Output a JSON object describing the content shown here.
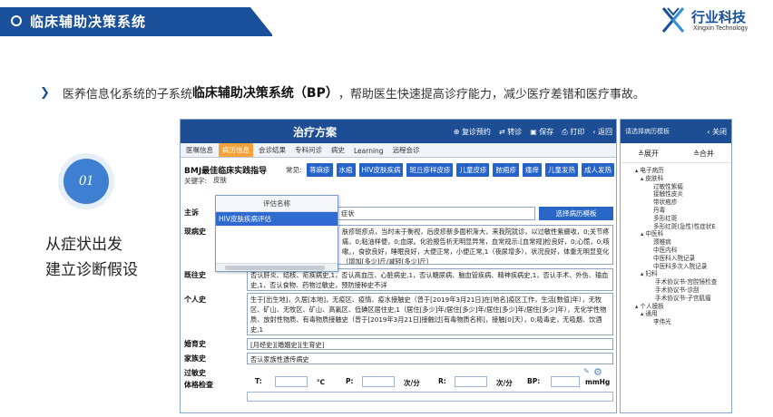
{
  "slide": {
    "title": "临床辅助决策系统",
    "logo": {
      "name": "行业科技",
      "name_en": "Xingxin Technology"
    },
    "intro_prefix": "医养信息化系统的子系统",
    "intro_bold": "临床辅助决策系统（BP）",
    "intro_suffix": "，帮助医生快速提高诊疗能力，减少医疗差错和医疗事故。",
    "step_number": "01",
    "step_line1": "从症状出发",
    "step_line2": "建立诊断假设"
  },
  "app": {
    "title": "治疗方案",
    "actions": [
      "复诊预约",
      "转诊",
      "保存",
      "打印",
      "返回"
    ],
    "tabs": [
      {
        "label": "医嘱信息",
        "active": false
      },
      {
        "label": "病历信息",
        "active": true
      },
      {
        "label": "会诊结果",
        "active": false
      },
      {
        "label": "专科问诊",
        "active": false
      },
      {
        "label": "病史",
        "active": false
      },
      {
        "label": "Learning",
        "active": false
      },
      {
        "label": "远程会诊",
        "active": false
      }
    ],
    "bmj_title": "BMJ最佳临床实践指导",
    "keyword_label": "关键字:",
    "keyword_value": "皮肤",
    "common_label": "常见:",
    "chips": [
      "荨麻疹",
      "水疱",
      "HIV皮肤疾病",
      "斑丘疹样皮疹",
      "儿童皮疹",
      "脓疱疹",
      "瘙痒",
      "儿童发热",
      "成人发热"
    ],
    "dropdown": {
      "header": "评估名称",
      "selected": "HIV皮肤疾病评估"
    },
    "fields": {
      "chief_label": "主诉",
      "chief_value": "症状",
      "template_button": "选择病历模板",
      "present_label": "现病史",
      "present_value": "肤疹斑疹点，当时未于衡视，后皮疹新多面积渐大，来我院就诊，以过敏性紫癜收，0;关节疼痛，0;粘油样便，0;血尿。化验报告析无明显异常，血常规示:[血常规]检良好，0;心慌，0;咳嗽。，食欲良好，睡眠良好，大便正常，小便正常,1（夜尿增多），状况良好，体重无明显变化（增加[多少]斤/减轻[多少]斤）",
      "past_label": "既往史",
      "past_value": "否认肝炎、结核、疟疾病史,1，否认高血压、心脏病史,1，否认糖尿病、脑血管疾病、精神疾病史,1，否认手术、外伤、输血史,1，否认食物、药物过敏史，预防接种史不详",
      "personal_label": "个人史",
      "personal_value": "生于[出生地]，久居[本地]，无疫区、疫情、疫水接触史（曾于[2019年3月21日]在[地名]疫区工作，生活[数值]年），无牧区、矿山、无牧区、矿山、高氟区、低碘区居住史,1（居住[多少]年/居住[多少]年/居住[多少]年/居住[多少]年），无化学性物质、放射性物质、有毒物质接触史（曾于[2019年3月21日]接触过[有毒物质名称]，接触[0]天），0;吸毒史，无吸烟、饮酒史,1",
      "marriage_label": "婚育史",
      "marriage_value": "[月经史][婚姻史][生育史]",
      "family_label": "家族史",
      "family_value": "否认家族性遗传病史",
      "allergy_label": "过敏史",
      "exam_label": "体格检查"
    },
    "vitals": {
      "t_label": "T:",
      "t_unit": "℃",
      "p_label": "P:",
      "p_unit": "次/分",
      "r_label": "R:",
      "r_unit": "次/分",
      "bp_label": "BP:",
      "bp_unit": "mmHg"
    }
  },
  "panel": {
    "title": "请选择病历模板",
    "close": "关闭",
    "expand": "展开",
    "collapse": "合并",
    "tree": [
      {
        "level": 1,
        "label": "电子病历"
      },
      {
        "level": 2,
        "label": "皮肤科"
      },
      {
        "level": 3,
        "label": "过敏性紫癜"
      },
      {
        "level": 3,
        "label": "接触性皮炎"
      },
      {
        "level": 3,
        "label": "带状疱疹"
      },
      {
        "level": 3,
        "label": "丹毒"
      },
      {
        "level": 3,
        "label": "多形红斑"
      },
      {
        "level": 3,
        "label": "多形红斑(急性)性症状E"
      },
      {
        "level": 2,
        "label": "中医科"
      },
      {
        "level": 3,
        "label": "颈椎病"
      },
      {
        "level": 3,
        "label": "中医内科"
      },
      {
        "level": 3,
        "label": "中医科入院记录"
      },
      {
        "level": 3,
        "label": "中医科多次入院记录"
      },
      {
        "level": 2,
        "label": "妇科"
      },
      {
        "level": 4,
        "label": "手术协议书-宫腔镜检查"
      },
      {
        "level": 4,
        "label": "手术协议书-诊刮"
      },
      {
        "level": 4,
        "label": "手术协议书-子宫肌瘤"
      },
      {
        "level": 1,
        "label": "个人模板"
      },
      {
        "level": 2,
        "label": "通用"
      },
      {
        "level": 3,
        "label": "李伟光"
      }
    ]
  }
}
